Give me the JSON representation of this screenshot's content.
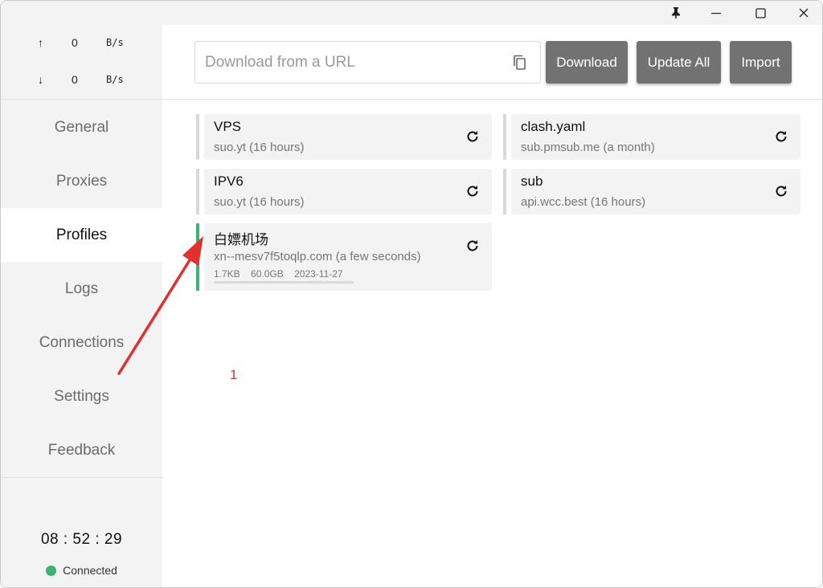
{
  "traffic": {
    "up_arrow": "↑",
    "up_value": "0",
    "up_unit": "B/s",
    "down_arrow": "↓",
    "down_value": "0",
    "down_unit": "B/s"
  },
  "nav": {
    "items": [
      {
        "label": "General"
      },
      {
        "label": "Proxies"
      },
      {
        "label": "Profiles"
      },
      {
        "label": "Logs"
      },
      {
        "label": "Connections"
      },
      {
        "label": "Settings"
      },
      {
        "label": "Feedback"
      }
    ],
    "active": "Profiles"
  },
  "clock": "08 : 52 : 29",
  "status": {
    "label": "Connected",
    "color": "#3cb371"
  },
  "toolbar": {
    "url_placeholder": "Download from a URL",
    "url_value": "",
    "download_label": "Download",
    "update_all_label": "Update All",
    "import_label": "Import"
  },
  "profiles": [
    {
      "name": "VPS",
      "sub": "suo.yt (16 hours)"
    },
    {
      "name": "clash.yaml",
      "sub": "sub.pmsub.me (a month)"
    },
    {
      "name": "IPV6",
      "sub": "suo.yt (16 hours)"
    },
    {
      "name": "sub",
      "sub": "api.wcc.best (16 hours)"
    },
    {
      "name": "白嫖机场",
      "sub": "xn--mesv7f5toqlp.com (a few seconds)",
      "used": "1.7KB",
      "total": "60.0GB",
      "expire": "2023-11-27",
      "usage_fraction": 0.0,
      "selected": true
    }
  ],
  "annotation": {
    "label": "1",
    "color": "#e03030"
  },
  "colors": {
    "accent": "#3cb371",
    "button": "#727272",
    "sidebar": "#f3f3f3"
  }
}
